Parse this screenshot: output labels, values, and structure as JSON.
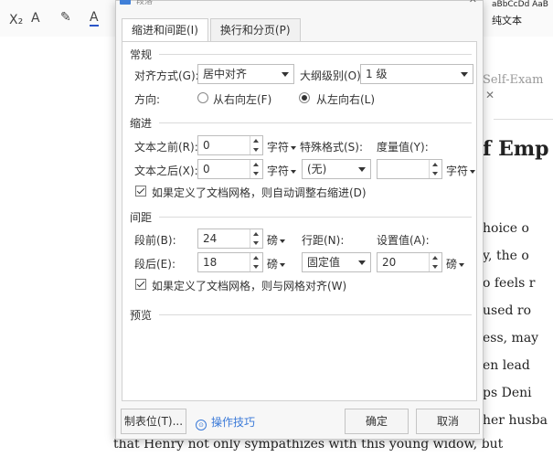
{
  "background": {
    "toolbar": {
      "x2_glyph": "X₂",
      "a_glyph": "A",
      "a2_glyph": "A",
      "style_sample": "aBbCcDd AaB",
      "pure_text": "纯文本"
    },
    "right_text": [
      "Self-Exam",
      "f Emp",
      "hoice o",
      "y, the o",
      "o feels r",
      "used ro",
      "ess, may",
      "en lead",
      "ps Deni",
      "her husba"
    ],
    "bottom_text": "that Henry not only sympathizes with this young widow, but"
  },
  "dialog": {
    "title": "段落",
    "close_label": "✕",
    "tabs": [
      {
        "label": "缩进和间距(I)",
        "active": true
      },
      {
        "label": "换行和分页(P)",
        "active": false
      }
    ],
    "general": {
      "section": "常规",
      "alignment_label": "对齐方式(G):",
      "alignment_value": "居中对齐",
      "outline_label": "大纲级别(O):",
      "outline_value": "1 级",
      "direction_label": "方向:",
      "rtl_label": "从右向左(F)",
      "ltr_label": "从左向右(L)",
      "direction_selected": "ltr"
    },
    "indent": {
      "section": "缩进",
      "before_label": "文本之前(R):",
      "before_value": "0",
      "before_unit": "字符",
      "after_label": "文本之后(X):",
      "after_value": "0",
      "after_unit": "字符",
      "special_label": "特殊格式(S):",
      "special_value": "(无)",
      "measure_label": "度量值(Y):",
      "measure_value": "",
      "measure_unit": "字符",
      "grid_checkbox_label": "如果定义了文档网格，则自动调整右缩进(D)",
      "grid_checked": true
    },
    "spacing": {
      "section": "间距",
      "before_label": "段前(B):",
      "before_value": "24",
      "before_unit": "磅",
      "after_label": "段后(E):",
      "after_value": "18",
      "after_unit": "磅",
      "line_label": "行距(N):",
      "line_value": "固定值",
      "set_label": "设置值(A):",
      "set_value": "20",
      "set_unit": "磅",
      "grid_checkbox_label": "如果定义了文档网格，则与网格对齐(W)",
      "grid_checked": true
    },
    "preview": {
      "section": "预览"
    },
    "footer": {
      "tabs_button": "制表位(T)...",
      "tips_icon": "⊙",
      "tips_label": "操作技巧",
      "ok_button": "确定",
      "cancel_button": "取消"
    }
  }
}
